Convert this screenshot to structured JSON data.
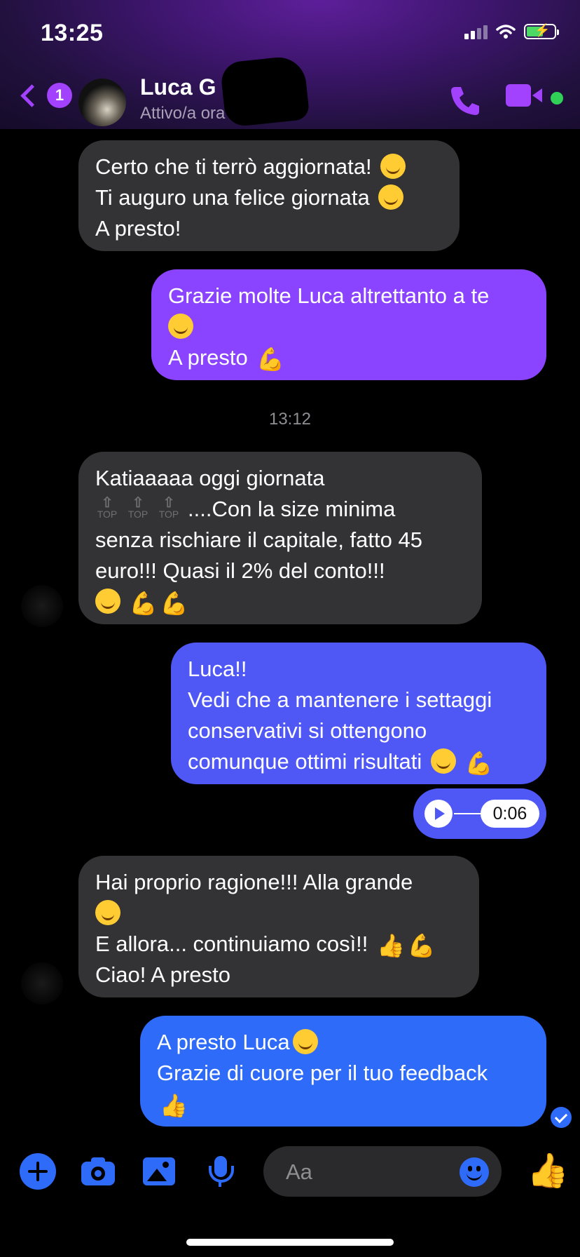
{
  "status_bar": {
    "time": "13:25"
  },
  "header": {
    "back_badge": "1",
    "contact_name": "Luca G",
    "contact_status": "Attivo/a ora"
  },
  "messages": [
    {
      "from": "contact",
      "lines": [
        "Certo che ti terrò aggiornata!",
        "Ti auguro una felice giornata",
        "A presto!"
      ]
    },
    {
      "from": "me",
      "lines": [
        "Grazie molte Luca altrettanto a te",
        "",
        "A presto"
      ]
    },
    {
      "from": "contact",
      "lines": [
        "Katiaaaaa oggi giornata",
        "....Con la size minima",
        "senza rischiare il capitale, fatto 45",
        "euro!!! Quasi il 2% del conto!!!",
        ""
      ],
      "top_icon_label": "TOP"
    },
    {
      "from": "me",
      "lines": [
        "Luca!!",
        "Vedi che a mantenere i settaggi",
        "conservativi si ottengono",
        "comunque ottimi risultati"
      ]
    },
    {
      "from": "contact",
      "lines": [
        "Hai proprio ragione!!! Alla grande",
        "",
        "E allora... continuiamo così!!",
        "Ciao! A presto"
      ]
    },
    {
      "from": "me",
      "lines": [
        "A presto Luca",
        "Grazie di cuore per il tuo feedback",
        ""
      ]
    }
  ],
  "timestamp": "13:12",
  "voice_message": {
    "duration": "0:06"
  },
  "composer": {
    "placeholder": "Aa"
  },
  "colors": {
    "accent_purple": "#a242ff",
    "bubble_incoming": "#333335",
    "bubble_out_purple": "#8a44ff",
    "bubble_out_indigo": "#4f57f5",
    "bubble_out_blue": "#2e6bf9",
    "online_green": "#31d158"
  },
  "icons": [
    "back-chevron-icon",
    "phone-icon",
    "video-camera-icon",
    "plus-icon",
    "camera-icon",
    "gallery-icon",
    "microphone-icon",
    "emoji-icon",
    "thumbs-up-icon",
    "play-icon",
    "seen-check-icon"
  ]
}
